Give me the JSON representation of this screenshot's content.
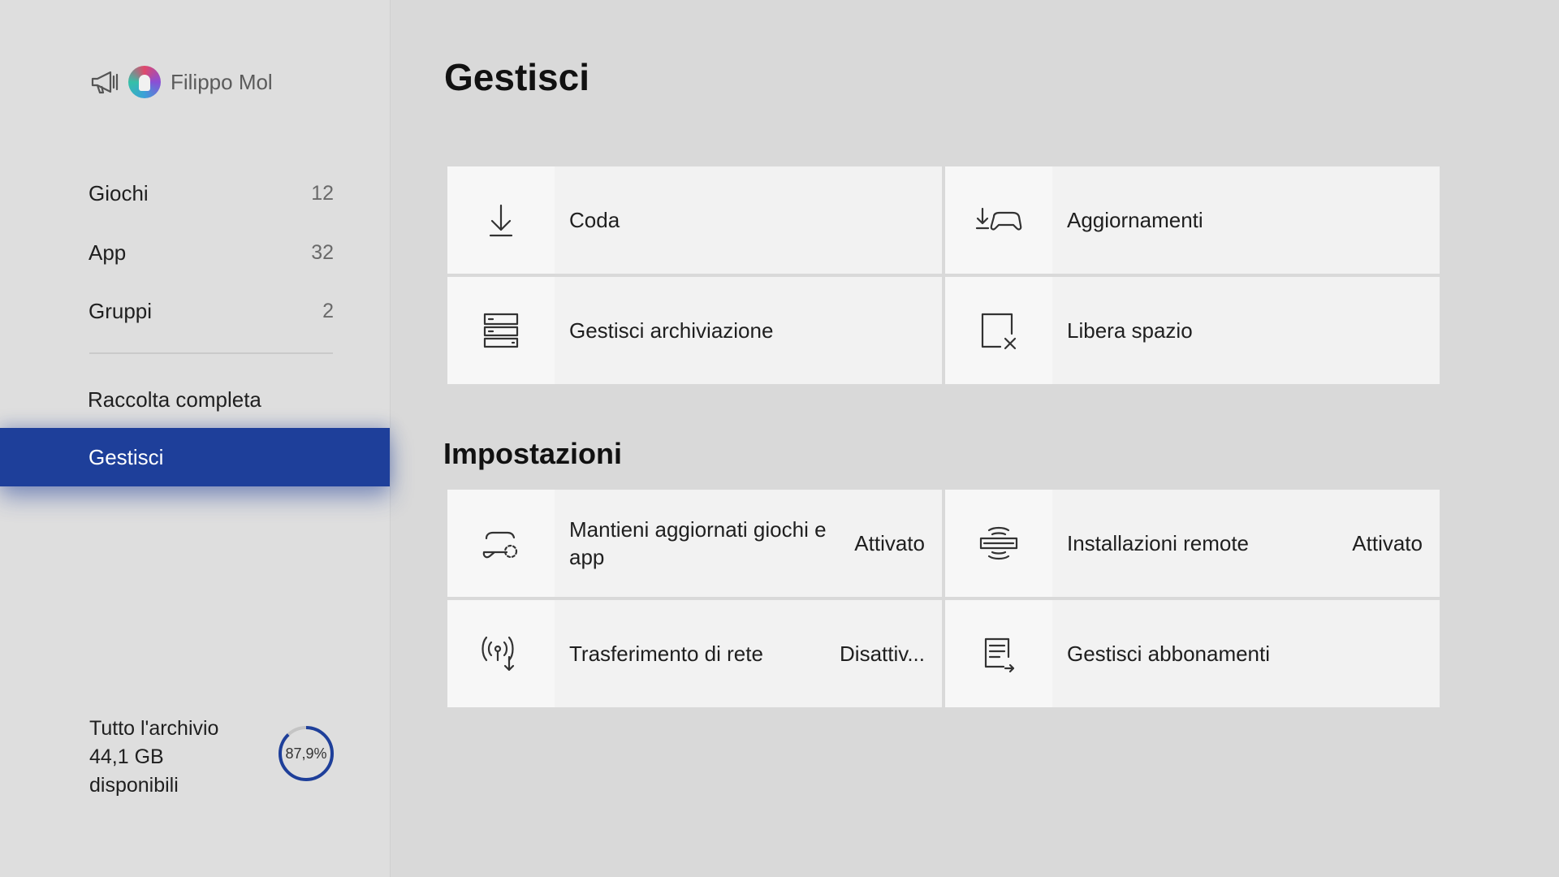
{
  "sidebar": {
    "profile": {
      "gamertag": "Filippo Mol"
    },
    "items": [
      {
        "label": "Giochi",
        "count": "12"
      },
      {
        "label": "App",
        "count": "32"
      },
      {
        "label": "Gruppi",
        "count": "2"
      }
    ],
    "full_collection": "Raccolta completa",
    "selected": "Gestisci",
    "storage": {
      "line1": "Tutto l'archivio",
      "line2": "44,1 GB",
      "line3": "disponibili",
      "used_percent_label": "87,9%",
      "used_fraction": 0.879
    }
  },
  "main": {
    "title": "Gestisci",
    "tiles": [
      {
        "label": "Coda",
        "icon": "download-icon"
      },
      {
        "label": "Aggiornamenti",
        "icon": "download-controller-icon"
      },
      {
        "label": "Gestisci archiviazione",
        "icon": "storage-icon"
      },
      {
        "label": "Libera spazio",
        "icon": "free-space-icon"
      }
    ],
    "settings_title": "Impostazioni",
    "settings": [
      {
        "label": "Mantieni aggiornati giochi e app",
        "value": "Attivato",
        "icon": "controller-updating-icon"
      },
      {
        "label": "Installazioni remote",
        "value": "Attivato",
        "icon": "remote-install-icon"
      },
      {
        "label": "Trasferimento di rete",
        "value": "Disattiv...",
        "icon": "network-transfer-icon"
      },
      {
        "label": "Gestisci abbonamenti",
        "value": "",
        "icon": "subscriptions-icon"
      }
    ]
  },
  "colors": {
    "accent": "#1e3f9a",
    "background": "#d9d9d9",
    "tile": "#f2f2f2"
  }
}
